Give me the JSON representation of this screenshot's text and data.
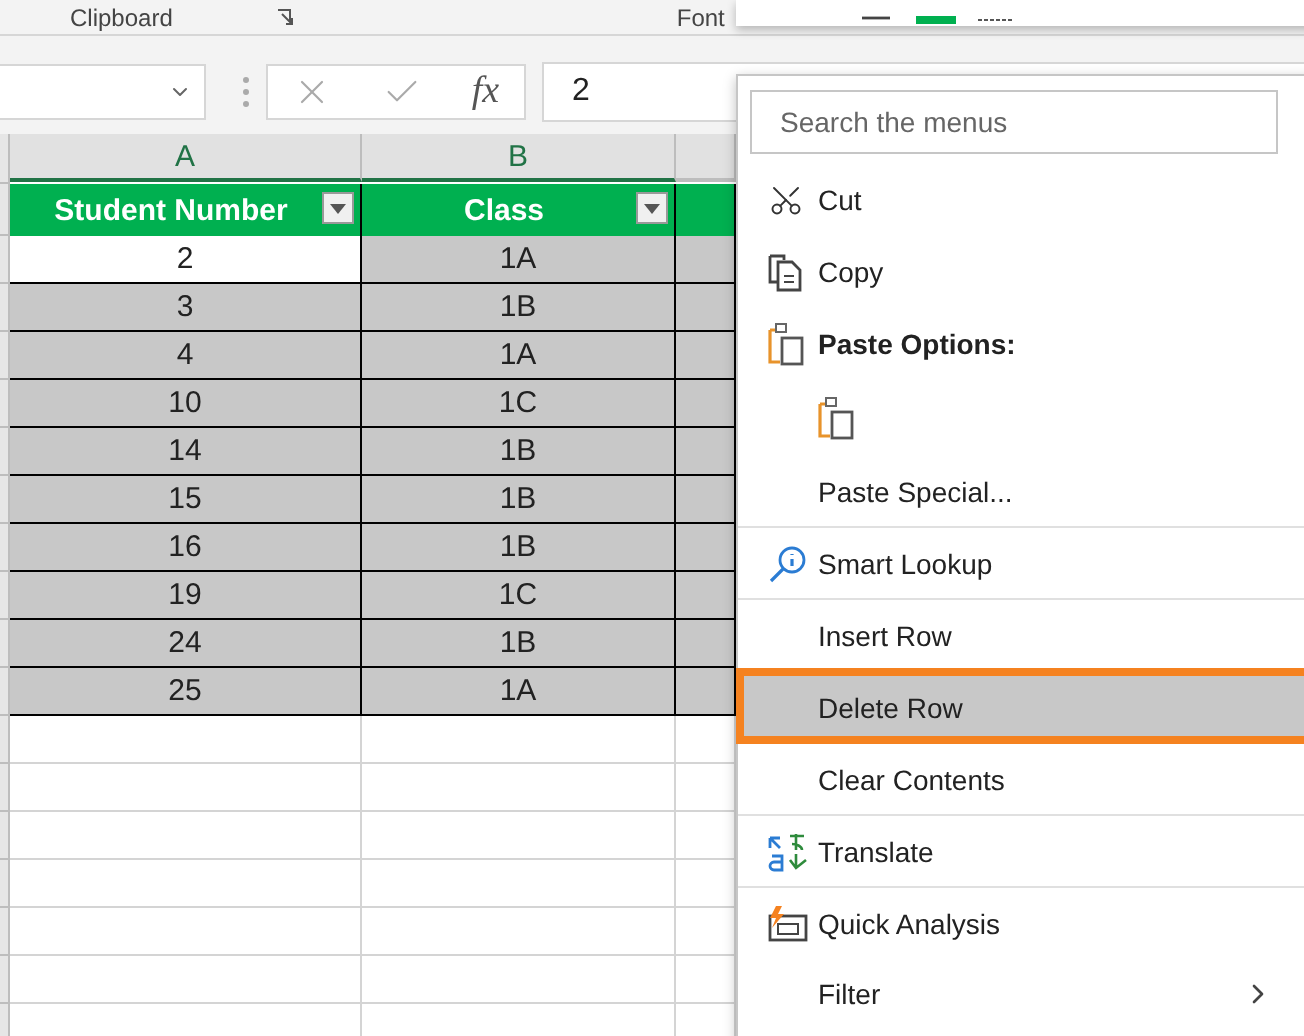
{
  "ribbon": {
    "groups": [
      {
        "label": "Clipboard"
      },
      {
        "label": "Font"
      }
    ]
  },
  "formula_bar": {
    "function_label": "fx",
    "value": "2"
  },
  "sheet": {
    "columns": [
      "A",
      "B"
    ],
    "table": {
      "headers": [
        "Student Number",
        "Class"
      ],
      "rows": [
        {
          "cells": [
            "2",
            "1A"
          ],
          "active": true
        },
        {
          "cells": [
            "3",
            "1B"
          ],
          "active": false
        },
        {
          "cells": [
            "4",
            "1A"
          ],
          "active": false
        },
        {
          "cells": [
            "10",
            "1C"
          ],
          "active": false
        },
        {
          "cells": [
            "14",
            "1B"
          ],
          "active": false
        },
        {
          "cells": [
            "15",
            "1B"
          ],
          "active": false
        },
        {
          "cells": [
            "16",
            "1B"
          ],
          "active": false
        },
        {
          "cells": [
            "19",
            "1C"
          ],
          "active": false
        },
        {
          "cells": [
            "24",
            "1B"
          ],
          "active": false
        },
        {
          "cells": [
            "25",
            "1A"
          ],
          "active": false
        }
      ]
    }
  },
  "context_menu": {
    "search": {
      "placeholder": "Search the menus"
    },
    "items": [
      {
        "kind": "cut",
        "label": "Cut",
        "separator_above": false,
        "selected": false
      },
      {
        "kind": "copy",
        "label": "Copy",
        "separator_above": false,
        "selected": false
      },
      {
        "kind": "header",
        "label": "Paste Options:",
        "separator_above": false,
        "selected": false
      },
      {
        "kind": "paste-options",
        "separator_above": false,
        "selected": false
      },
      {
        "kind": "plain",
        "label": "Paste Special...",
        "separator_above": false,
        "selected": false
      },
      {
        "kind": "lookup",
        "label": "Smart Lookup",
        "separator_above": true,
        "selected": false
      },
      {
        "kind": "plain",
        "label": "Insert Row",
        "separator_above": true,
        "selected": false
      },
      {
        "kind": "plain",
        "label": "Delete Row",
        "separator_above": false,
        "selected": true
      },
      {
        "kind": "plain",
        "label": "Clear Contents",
        "separator_above": false,
        "selected": false
      },
      {
        "kind": "translate",
        "label": "Translate",
        "separator_above": true,
        "selected": false
      },
      {
        "kind": "analysis",
        "label": "Quick Analysis",
        "separator_above": true,
        "selected": false
      },
      {
        "kind": "submenu",
        "label": "Filter",
        "separator_above": false,
        "selected": false
      }
    ]
  }
}
